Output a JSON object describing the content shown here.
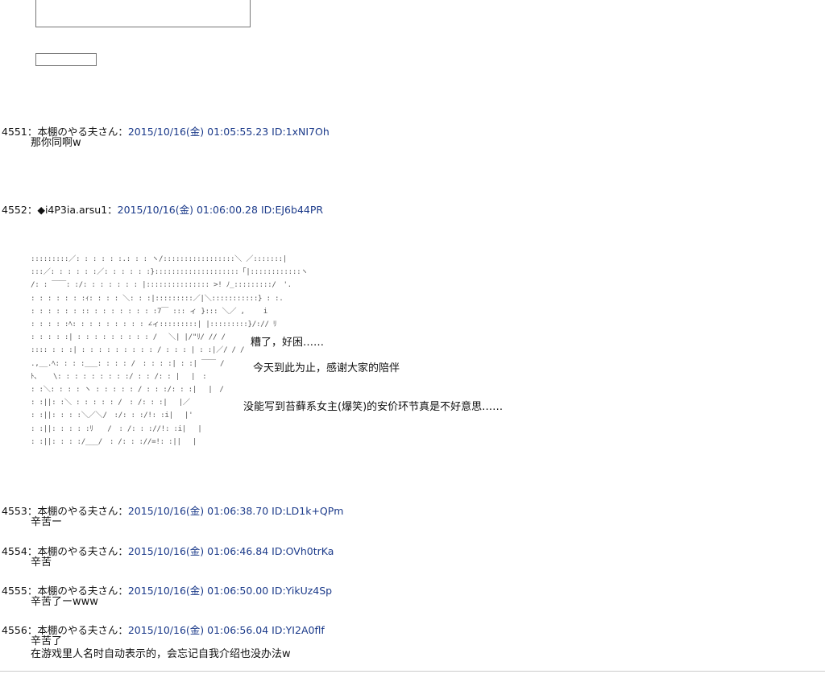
{
  "posts": [
    {
      "number": "4551",
      "name": "本棚のやる夫さん",
      "datetime": "2015/10/16(金) 01:05:55.23",
      "id": "ID:1xNI7Oh",
      "body": [
        "那你同啊w"
      ]
    },
    {
      "number": "4552",
      "name": "◆i4P3ia.arsu1",
      "datetime": "2015/10/16(金) 01:06:00.28",
      "id": "ID:EJ6b44PR",
      "body": []
    },
    {
      "number": "4553",
      "name": "本棚のやる夫さん",
      "datetime": "2015/10/16(金) 01:06:38.70",
      "id": "ID:LD1k+QPm",
      "body": [
        "辛苦ー"
      ]
    },
    {
      "number": "4554",
      "name": "本棚のやる夫さん",
      "datetime": "2015/10/16(金) 01:06:46.84",
      "id": "ID:OVh0trKa",
      "body": [
        "辛苦"
      ]
    },
    {
      "number": "4555",
      "name": "本棚のやる夫さん",
      "datetime": "2015/10/16(金) 01:06:50.00",
      "id": "ID:YikUz4Sp",
      "body": [
        "辛苦了ーwww"
      ]
    },
    {
      "number": "4556",
      "name": "本棚のやる夫さん",
      "datetime": "2015/10/16(金) 01:06:56.04",
      "id": "ID:YI2A0flf",
      "body": [
        "辛苦了",
        "在游戏里人名时自动表示的，会忘记自我介绍也没办法w"
      ]
    }
  ],
  "separator": "：",
  "ascii_art": [
    ":::::::::／: : : : : :.: : : ヽ/:::::::::::::::::＼ ／:::::::|",
    ":::／: : : : : :／: : : : : :}::::::::::::::::::::「|::::::::::::ヽ",
    "/: : ￣￣: :/: : : : : : : |::::::::::::::: >! ﾉ_:::::::::/　'.",
    ": : : : : : :ｨ: : : : ＼: : :|:::::::::／|＼:::::::::::} : :.",
    ": : : : : : :: : : : : : : : :7￣ ::: ィ }::: ＼／ ,　　 i",
    ": : : : :ﾍ: : : : : : : : : ∠ィ:::::::::| |:::::::::}/:// ﾘ",
    ": : : : :| : : : : : : : : : / 　＼| |/\"ﾘ/ // /",
    ":::: : : :| : : : : : : : : : / : : : | : :|／/ / /",
    ".,__.ﾍ: : : :___: : : : /　: : : :| : :| ￣￣ /",
    "ﾄ､ 　 \\: : : : : : : : :/ : : /: : |　 |　:",
    ": :＼: : : : ヽ : : : : : / : : :/: : :|　 |　/",
    ": :||: :＼ : : : : : /　: /: : :|　 |／",
    ": :||: : : :＼／＼/　:/: : :/!: :i|　 |'",
    ": :||: : : : :ﾘ　　/　: /: : ://!: :i|　 |",
    ": :||: : : :/___/　: /: : ://=!: :||　 |"
  ],
  "dialog": [
    "糟了，好困……",
    "今天到此为止，感谢大家的陪伴",
    "没能写到苔藓系女主(爆笑)的安价环节真是不好意思……"
  ]
}
